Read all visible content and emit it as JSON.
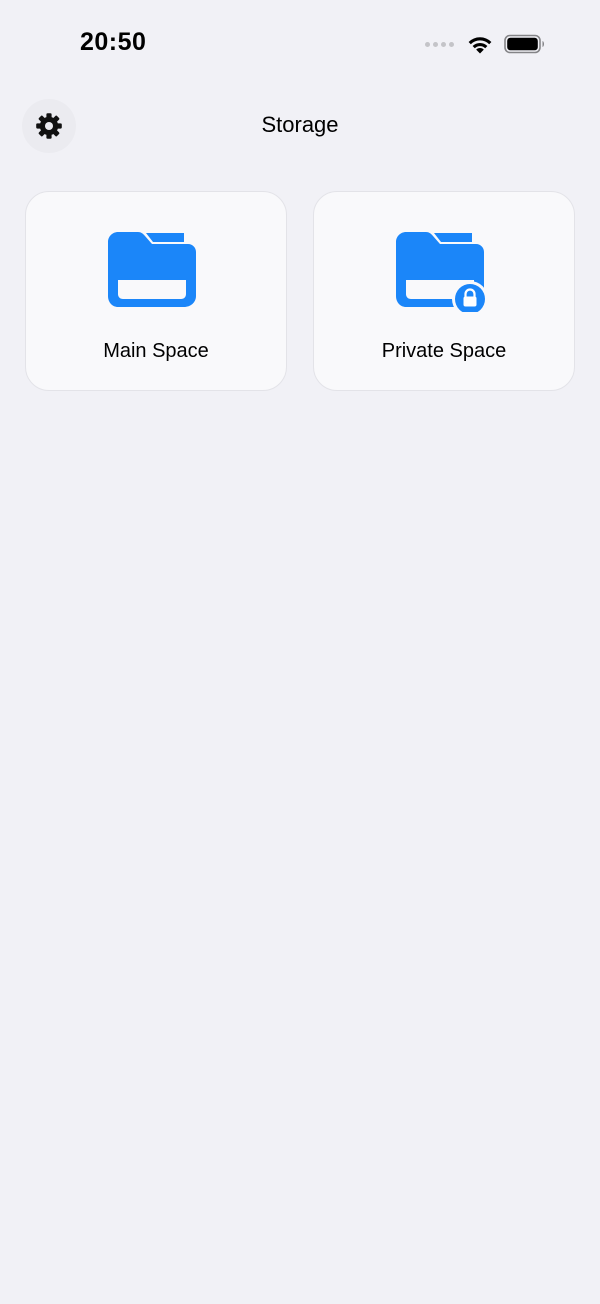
{
  "status_bar": {
    "time": "20:50",
    "signal_icon": "cellular-signal-dots-icon",
    "wifi_icon": "wifi-icon",
    "battery_icon": "battery-icon"
  },
  "header": {
    "title": "Storage",
    "settings_icon": "gear-icon"
  },
  "spaces": [
    {
      "label": "Main Space",
      "icon": "folder-icon"
    },
    {
      "label": "Private Space",
      "icon": "folder-lock-icon"
    }
  ],
  "colors": {
    "accent": "#1b86f9",
    "background": "#f1f1f6",
    "card_background": "#f9f9fb"
  }
}
